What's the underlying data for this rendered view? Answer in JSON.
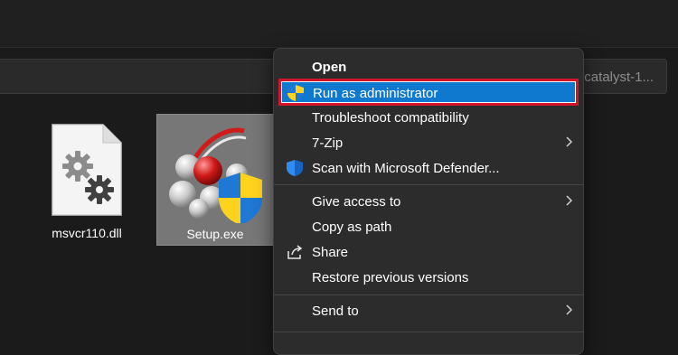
{
  "address_bar": {
    "text": "d-catalyst-1..."
  },
  "files": [
    {
      "name": "msvcr110.dll",
      "icon": "gear-document-icon"
    },
    {
      "name": "Setup.exe",
      "icon": "setup-shield-icon"
    }
  ],
  "context_menu": {
    "items": [
      {
        "label": "Open",
        "bold": true
      },
      {
        "label": "Run as administrator",
        "icon": "uac-shield-icon",
        "highlighted": true
      },
      {
        "label": "Troubleshoot compatibility"
      },
      {
        "label": "7-Zip",
        "submenu": true
      },
      {
        "label": "Scan with Microsoft Defender...",
        "icon": "defender-shield-icon"
      },
      {
        "label": "Give access to",
        "submenu": true
      },
      {
        "label": "Copy as path"
      },
      {
        "label": "Share",
        "icon": "share-icon"
      },
      {
        "label": "Restore previous versions"
      },
      {
        "label": "Send to",
        "submenu": true
      }
    ]
  },
  "colors": {
    "highlight": "#0f79d0",
    "highlight_border": "#d2152a",
    "menu_background": "#2c2c2c",
    "window_background": "#1b1b1b"
  }
}
